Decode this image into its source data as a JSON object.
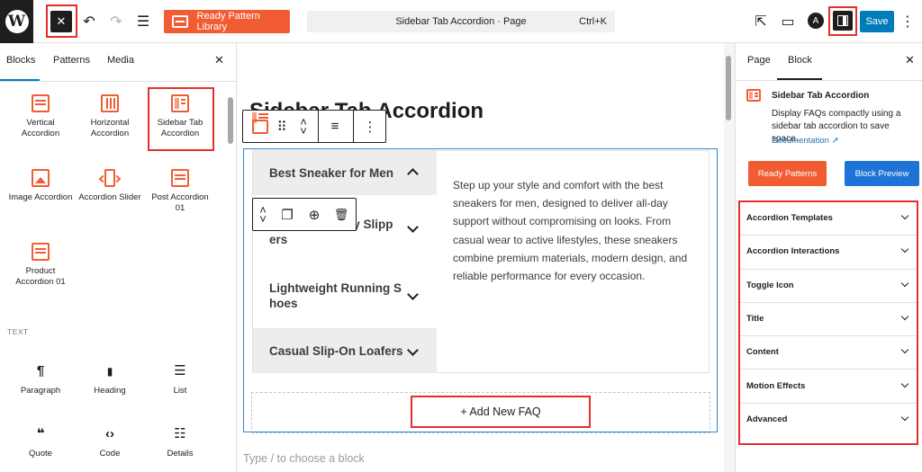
{
  "topbar": {
    "wp_logo": "W",
    "close_symbol": "✕",
    "undo_symbol": "↶",
    "redo_symbol": "↷",
    "outline_symbol": "☰",
    "ready_pattern_label": "Ready Pattern Library",
    "command_title": "Sidebar Tab Accordion · Page",
    "command_shortcut": "Ctrl+K",
    "view_symbol": "⇱",
    "preview_symbol": "▭",
    "astra_symbol": "A",
    "save_label": "Save",
    "more_symbol": "⋮"
  },
  "inserter": {
    "tabs": [
      "Blocks",
      "Patterns",
      "Media"
    ],
    "close_symbol": "✕",
    "blocks": [
      {
        "label": "Vertical Accordion",
        "icon": "vertical-accordion-icon"
      },
      {
        "label": "Horizontal Accordion",
        "icon": "horizontal-accordion-icon"
      },
      {
        "label": "Sidebar Tab Accordion",
        "icon": "sidebar-tab-accordion-icon"
      },
      {
        "label": "Image Accordion",
        "icon": "image-accordion-icon"
      },
      {
        "label": "Accordion Slider",
        "icon": "accordion-slider-icon"
      },
      {
        "label": "Post Accordion 01",
        "icon": "post-accordion-icon"
      },
      {
        "label": "Product Accordion 01",
        "icon": "product-accordion-icon"
      }
    ],
    "text_heading": "TEXT",
    "text_blocks": [
      {
        "label": "Paragraph",
        "glyph": "¶"
      },
      {
        "label": "Heading",
        "glyph": "🔖"
      },
      {
        "label": "List",
        "glyph": "☰"
      },
      {
        "label": "Quote",
        "glyph": "❝"
      },
      {
        "label": "Code",
        "glyph": "‹›"
      },
      {
        "label": "Details",
        "glyph": "☷"
      }
    ]
  },
  "canvas": {
    "page_title": "Sidebar Tab Accordion",
    "block_toolbar": {
      "drag": "⠿",
      "up": "˄",
      "down": "˅",
      "align": "≡",
      "more": "⋮"
    },
    "inner_toolbar": {
      "up": "˄",
      "down": "˅",
      "duplicate": "❐",
      "add": "⊕",
      "delete": "🗑"
    },
    "faq_items": [
      {
        "label": "Best Sneaker for Men",
        "active": true
      },
      {
        "label": "by Slipp ers",
        "active": false
      },
      {
        "label": "Lightweight Running S hoes",
        "active": false
      },
      {
        "label": "Casual Slip-On Loafers",
        "active": false
      }
    ],
    "faq_item_2_line1": "by Slipp",
    "faq_item_2_line2": "ers",
    "faq_item_3_line1": "Lightweight Running S",
    "faq_item_3_line2": "hoes",
    "answer": "Step up your style and comfort with the best sneakers for men, designed to deliver all-day support without compromising on looks. From casual wear to active lifestyles, these sneakers combine premium materials, modern design, and reliable performance for every occasion.",
    "add_faq_label": "+  Add New FAQ",
    "type_hint": "Type / to choose a block"
  },
  "sidebar": {
    "tabs": [
      "Page",
      "Block"
    ],
    "close_symbol": "✕",
    "block_name": "Sidebar Tab Accordion",
    "block_description": "Display FAQs compactly using a sidebar tab accordion to save space.",
    "documentation_link": "Documentation ↗",
    "ready_patterns_label": "Ready Patterns",
    "block_preview_label": "Block Preview",
    "sections": [
      "Accordion Templates",
      "Accordion Interactions",
      "Toggle Icon",
      "Title",
      "Content",
      "Motion Effects",
      "Advanced"
    ]
  },
  "colors": {
    "brand_orange": "#f25c33",
    "wp_blue": "#007cba",
    "preview_blue": "#1e73d6",
    "highlight_red": "#e52e2e"
  }
}
